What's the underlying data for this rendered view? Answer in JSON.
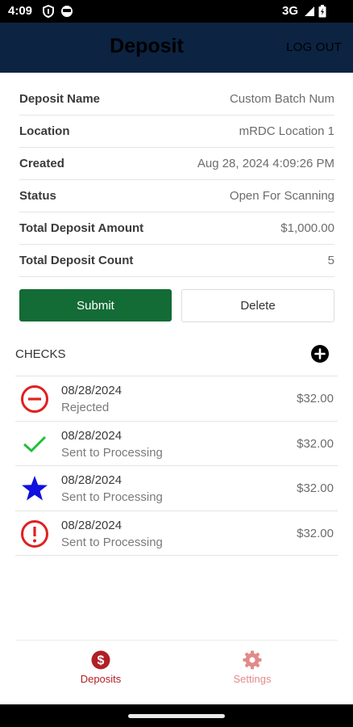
{
  "status_bar": {
    "time": "4:09",
    "network": "3G",
    "icons": [
      "shield-icon",
      "face-icon",
      "signal-icon",
      "battery-icon"
    ]
  },
  "header": {
    "title": "Deposit",
    "logout_label": "LOG OUT",
    "background": "#0c2342"
  },
  "details": [
    {
      "label": "Deposit Name",
      "value": "Custom Batch Num"
    },
    {
      "label": "Location",
      "value": "mRDC Location 1"
    },
    {
      "label": "Created",
      "value": "Aug 28, 2024 4:09:26 PM"
    },
    {
      "label": "Status",
      "value": "Open For Scanning"
    },
    {
      "label": "Total Deposit Amount",
      "value": "$1,000.00"
    },
    {
      "label": "Total Deposit Count",
      "value": "5"
    }
  ],
  "actions": {
    "submit_label": "Submit",
    "delete_label": "Delete",
    "submit_color": "#136b36"
  },
  "checks": {
    "heading": "CHECKS",
    "add_icon": "plus-circle-icon",
    "items": [
      {
        "date": "08/28/2024",
        "status": "Rejected",
        "amount": "$32.00",
        "icon": "minus-circle-icon",
        "icon_color": "#e02020"
      },
      {
        "date": "08/28/2024",
        "status": "Sent to Processing",
        "amount": "$32.00",
        "icon": "checkmark-icon",
        "icon_color": "#1fbf3a"
      },
      {
        "date": "08/28/2024",
        "status": "Sent to Processing",
        "amount": "$32.00",
        "icon": "star-icon",
        "icon_color": "#1010e0"
      },
      {
        "date": "08/28/2024",
        "status": "Sent to Processing",
        "amount": "$32.00",
        "icon": "exclamation-circle-icon",
        "icon_color": "#e02020"
      }
    ]
  },
  "bottom_nav": {
    "items": [
      {
        "label": "Deposits",
        "icon": "dollar-circle-icon",
        "active": true
      },
      {
        "label": "Settings",
        "icon": "gear-icon",
        "active": false
      }
    ],
    "active_color": "#b11f26",
    "inactive_color": "#e38a8a"
  }
}
